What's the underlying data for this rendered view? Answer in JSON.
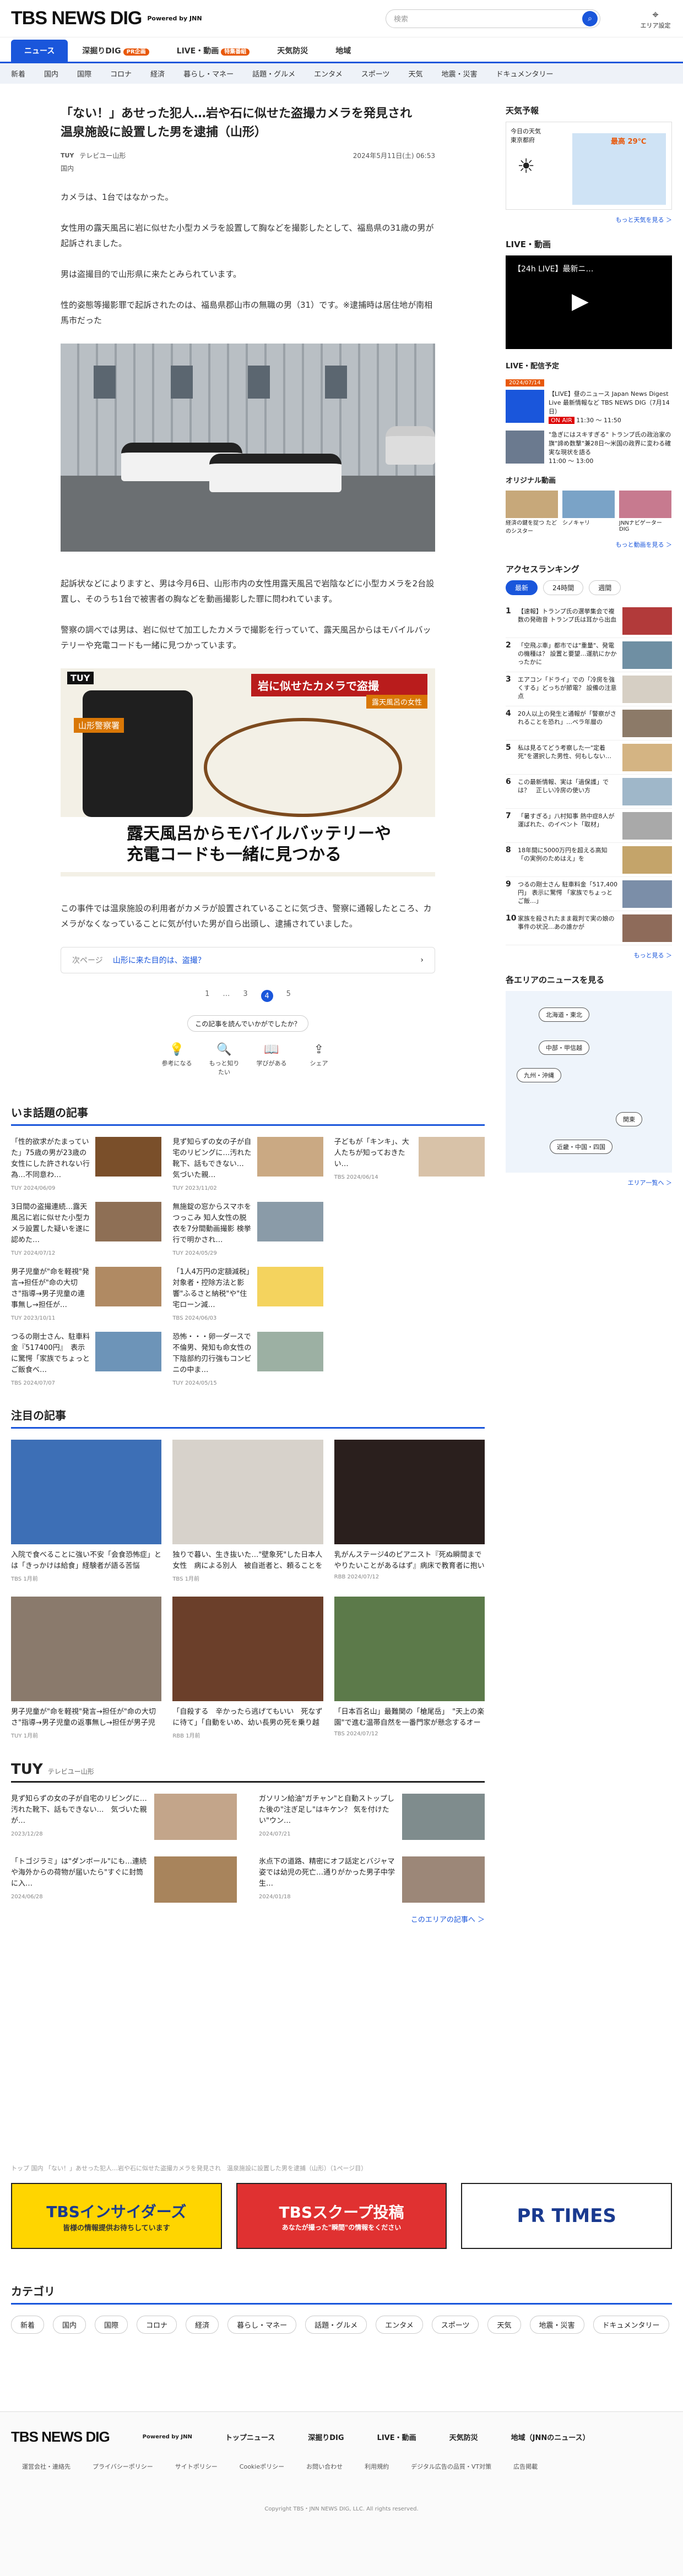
{
  "header": {
    "logo": "TBS NEWS DIG",
    "logo_sub": "Powered by JNN",
    "search_placeholder": "検索",
    "area_label": "エリア設定"
  },
  "gnav": [
    {
      "label": "ニュース",
      "active": true
    },
    {
      "label": "深掘りDIG",
      "badge": "PR企画"
    },
    {
      "label": "LIVE・動画",
      "badge": "特集番組"
    },
    {
      "label": "天気防災"
    },
    {
      "label": "地域"
    }
  ],
  "subnav": [
    "新着",
    "国内",
    "国際",
    "コロナ",
    "経済",
    "暮らし・マネー",
    "話題・グルメ",
    "エンタメ",
    "スポーツ",
    "天気",
    "地震・災害",
    "ドキュメンタリー"
  ],
  "article": {
    "title": "「ない！」あせった犯人…岩や石に似せた盗撮カメラを発見され　温泉施設に設置した男を逮捕（山形）",
    "source": "テレビユー山形",
    "date": "2024年5月11日(土) 06:53",
    "tag": "国内",
    "p1": "カメラは、1台ではなかった。",
    "p2": "女性用の露天風呂に岩に似せた小型カメラを設置して胸などを撮影したとして、福島県の31歳の男が起訴されました。",
    "p3": "男は盗撮目的で山形県に来たとみられています。",
    "p4": "性的姿態等撮影罪で起訴されたのは、福島県郡山市の無職の男（31）です。※逮捕時は居住地が南相馬市だった",
    "p5": "起訴状などによりますと、男は今月6日、山形市内の女性用露天風呂で岩陰などに小型カメラを2台設置し、そのうち1台で被害者の胸などを動画撮影した罪に問われています。",
    "p6": "警察の調べでは男は、岩に似せて加工したカメラで撮影を行っていて、露天風呂からはモバイルバッテリーや充電コードも一緒に見つかっています。",
    "p7": "この事件では温泉施設の利用者がカメラが設置されていることに気づき、警察に通報したところ、カメラがなくなっていることに気が付いた男が自ら出頭し、逮捕されていました。",
    "img2_red": "岩に似せたカメラで盗撮",
    "img2_sub": "露天風呂の女性",
    "img2_area": "山形警察署",
    "img2_bottom1": "露天風呂からモバイルバッテリーや",
    "img2_bottom2": "充電コードも一緒に見つかる",
    "img_logo": "TUY",
    "next_label": "次ページ",
    "next_title": "山形に来た目的は、盗撮？",
    "pages": [
      "1",
      "…",
      "3",
      "4",
      "5"
    ],
    "help": "この記事を読んでいかがでしたか？",
    "reactions": [
      "参考になる",
      "もっと知りたい",
      "学びがある",
      "シェア"
    ]
  },
  "topics": {
    "heading": "いま話題の記事",
    "items": [
      {
        "title": "「性的欲求がたまっていた」75歳の男が23歳の女性にした許されない行為…不同意わ…",
        "src": "TUY",
        "date": "2024/06/09"
      },
      {
        "title": "見ず知らずの女の子が自宅のリビングに…汚れた靴下、話もできない…　気づいた親…",
        "src": "TUY",
        "date": "2023/11/02"
      },
      {
        "title": "子どもが「キンキ」、大人たちが知っておきたい…",
        "src": "TBS",
        "date": "2024/06/14"
      },
      {
        "title": "3日間の盗撮連続…露天風呂に岩に似せた小型カメラ設置した疑いを遂に認めた…",
        "src": "TUY",
        "date": "2024/07/12"
      },
      {
        "title": "無施錠の窓からスマホをつっこみ 知人女性の脱衣を7分間動画撮影 検挙行で明かされ…",
        "src": "TUY",
        "date": "2024/05/29"
      },
      {
        "title": "",
        "src": "",
        "date": ""
      },
      {
        "title": "男子児童が\"命を軽視\"発言→担任が\"命の大切さ\"指導→男子児童の連事無し→担任が…",
        "src": "TUY",
        "date": "2023/10/11"
      },
      {
        "title": "「1人4万円の定額減税」対象者・控除方法と影響\"ふるさと納税\"や\"住宅ローン減…",
        "src": "TBS",
        "date": "2024/06/03"
      },
      {
        "title": "",
        "src": "",
        "date": ""
      },
      {
        "title": "つるの剛士さん、駐車料金『517400円』　表示に驚愕「家族でちょっとご飯食べ…",
        "src": "TBS",
        "date": "2024/07/07"
      },
      {
        "title": "恐怖・・・卵一ダースで不倫男、発知も命女性の下陰部約刃行強もコンビニの中ま…",
        "src": "TUY",
        "date": "2024/05/15"
      },
      {
        "title": "",
        "src": "",
        "date": ""
      }
    ]
  },
  "featured": {
    "heading": "注目の記事",
    "items": [
      {
        "title": "入院で食べることに強い不安「会食恐怖症」とは「きっかけは給食」経験者が語る苦悩",
        "src": "TBS",
        "date": "1月前"
      },
      {
        "title": "独りで暮い、生き抜いた…\"壁象死\"した日本人女性　病による別人　被自逝者と、頼ることをできな…",
        "src": "TBS",
        "date": "1月前"
      },
      {
        "title": "乳がんステージ4のピアニスト『死ぬ瞬間までやりたいことがあるはず』病床で教育者に抱いた…",
        "src": "RBB",
        "date": "2024/07/12"
      },
      {
        "title": "男子児童が\"命を軽視\"発言→担任が\"命の大切さ\"指導→男子児童の返事無し→担任が男子児童に「一緒…",
        "src": "TUY",
        "date": "1月前"
      },
      {
        "title": "「自殺する　辛かったら逃げてもいい　死なずに待て」「自動をいめ、幼い長男の死を乗り越えて…",
        "src": "RBB",
        "date": "1月前"
      },
      {
        "title": "「日本百名山」最難関の「槍尾岳」　\"天上の楽園\"で進む温帯自然を一番門家が懸念するオーバーユ…",
        "src": "TBS",
        "date": "2024/07/12"
      }
    ]
  },
  "tuy": {
    "heading": "TUY",
    "sub": "テレビユー山形",
    "items": [
      {
        "title": "見ず知らずの女の子が自宅のリビングに…汚れた靴下、話もできない…　気づいた親が…",
        "date": "2023/12/28"
      },
      {
        "title": "ガソリン給油\"ガチャン\"と自動ストップした後の\"注ぎ足し\"はキケン？ 気を付けたい\"ウン…",
        "date": "2024/07/21"
      },
      {
        "title": "「トゴジラミ」は\"ダンボール\"にも…連続や海外からの荷物が届いたら\"すぐに封筒に入…",
        "date": "2024/06/28"
      },
      {
        "title": "氷点下の道路、精密にオフ話定とバジャマ姿では幼児の死亡…通りがかった男子中学生…",
        "date": "2024/01/18"
      }
    ],
    "more": "このエリアの記事へ ＞"
  },
  "breadcrumb": "トップ  国内  「ない！」あせった犯人…岩や石に似せた盗撮カメラを発見され　温泉施設に設置した男を逮捕（山形）（1ページ目）",
  "banners": [
    "TBSインサイダーズ",
    "TBSスクープ投稿",
    "PR TIMES"
  ],
  "banner_subs": [
    "皆様の情報提供お待ちしています",
    "あなたが撮った\"瞬間\"の情報をください"
  ],
  "categories": {
    "heading": "カテゴリ",
    "items": [
      "新着",
      "国内",
      "国際",
      "コロナ",
      "経済",
      "暮らし・マネー",
      "話題・グルメ",
      "エンタメ",
      "スポーツ",
      "天気",
      "地震・災害",
      "ドキュメンタリー"
    ]
  },
  "footer": {
    "logo": "TBS NEWS DIG",
    "logo_sub": "Powered by JNN",
    "nav": [
      "トップニュース",
      "深掘りDIG",
      "LIVE・動画",
      "天気防災",
      "地域（JNNのニュース）"
    ],
    "links": [
      "運営会社・連絡先",
      "プライバシーポリシー",
      "サイトポリシー",
      "Cookieポリシー",
      "お問い合わせ",
      "利用規約",
      "デジタル広告の品質・VT対策",
      "広告掲載"
    ],
    "copy": "Copyright TBS・JNN NEWS DIG, LLC. All rights reserved."
  },
  "sidebar": {
    "weather_h": "天気予報",
    "weather_today": "今日の天気",
    "weather_city": "東京都府",
    "weather_temp": "29℃",
    "weather_max_label": "最高",
    "weather_more": "もっと天気を見る ＞",
    "live_h": "LIVE・動画",
    "video_title": "【24h LIVE】最新ニ…",
    "sched_h": "LIVE・配信予定",
    "sched_date": "2024/07/14",
    "sched": [
      {
        "title": "【LIVE】昼のニュース Japan News Digest Live 最新情報など TBS NEWS DIG（7月14日）",
        "badge": "ON AIR",
        "time": "11:30 〜 11:50"
      },
      {
        "title": "\"急ぎにはスキすぎる\" トランプ氏の政治家の旗\"諦め数撃\"兼28日〜米国の政界に変わる確実な現状を語る",
        "badge": "",
        "time": "11:00 〜 13:00"
      }
    ],
    "original_h": "オリジナル動画",
    "originals": [
      "経済の鍵を捉つ たどのシスター",
      "シノキャリ",
      "JNNナビゲーターDIG"
    ],
    "video_more": "もっと動画を見る ＞",
    "rank_h": "アクセスランキング",
    "rank_tabs": [
      "最新",
      "24時間",
      "週間"
    ],
    "ranks": [
      "【速報】トランプ氏の選挙集会で複数の発砲音 トランプ氏は耳から出血",
      "「空飛ぶ車」都市では\"重量\"、発電の機種は？ 設置と要望…運航にかかったかに",
      "エアコン「ドライ」での「冷房を強くする」どっちが節電？ 設備の注意点",
      "20人以上の発生と通報が「警察がされることを恐れ」…ベラ年層の",
      "私は見るてどう考察した一\"定着死\"を選択した男性、何もしない…",
      "この最新情報、実は「過保護」では？　正しい冷房の使い方",
      "「暑すぎる」八村知事 熱中症8人が運ばれた、のイベント「取材」",
      "18年間に5000万円を超える高知「の実例のためはえ」を",
      "つるの剛士さん 駐車料金「517,400円」 表示に驚愕 「家族でちょっとご飯…」",
      "家族を殺されたまま裁判で実の娘の事件の状況…あの誰かが"
    ],
    "rank_more": "もっと見る ＞",
    "region_h": "各エリアのニュースを見る",
    "regions": [
      "北海道・東北",
      "中部・甲信越",
      "九州・沖縄",
      "関東",
      "近畿・中国・四国"
    ],
    "region_more": "エリア一覧へ ＞"
  }
}
